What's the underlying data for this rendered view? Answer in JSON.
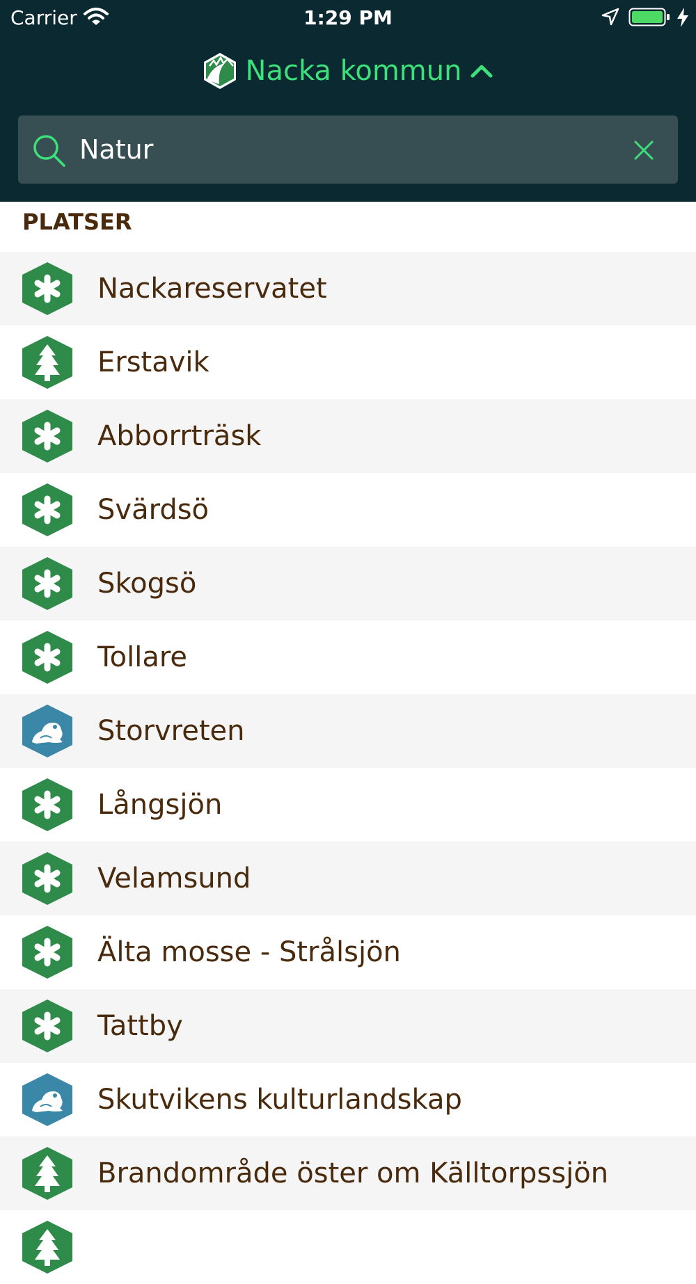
{
  "status_bar": {
    "carrier": "Carrier",
    "time": "1:29 PM",
    "icons": [
      "wifi-icon",
      "location-icon",
      "battery-icon",
      "charging-icon"
    ]
  },
  "header": {
    "title": "Nacka kommun",
    "logo_icon": "nacka-logo-icon",
    "toggle_icon": "chevron-up-icon",
    "background": "#0a2930",
    "accent": "#3de07a"
  },
  "search": {
    "value": "Natur",
    "placeholder": "",
    "search_icon": "search-icon",
    "clear_icon": "close-icon",
    "background": "#374f53"
  },
  "section": {
    "title": "PLATSER",
    "text_color": "#4a2a0d"
  },
  "places": [
    {
      "name": "Nackareservatet",
      "icon": "reserve-icon"
    },
    {
      "name": "Erstavik",
      "icon": "tree-icon"
    },
    {
      "name": "Abborrträsk",
      "icon": "reserve-icon"
    },
    {
      "name": "Svärdsö",
      "icon": "reserve-icon"
    },
    {
      "name": "Skogsö",
      "icon": "reserve-icon"
    },
    {
      "name": "Tollare",
      "icon": "reserve-icon"
    },
    {
      "name": "Storvreten",
      "icon": "frog-icon"
    },
    {
      "name": "Långsjön",
      "icon": "reserve-icon"
    },
    {
      "name": "Velamsund",
      "icon": "reserve-icon"
    },
    {
      "name": "Älta mosse - Strålsjön",
      "icon": "reserve-icon"
    },
    {
      "name": "Tattby",
      "icon": "reserve-icon"
    },
    {
      "name": "Skutvikens kulturlandskap",
      "icon": "frog-icon"
    },
    {
      "name": "Brandområde öster om Källtorpssjön",
      "icon": "tree-icon"
    },
    {
      "name": "",
      "icon": "tree-icon"
    }
  ],
  "icon_colors": {
    "reserve-icon": "#2e8b4a",
    "tree-icon": "#2e8b4a",
    "frog-icon": "#3a87a8"
  }
}
